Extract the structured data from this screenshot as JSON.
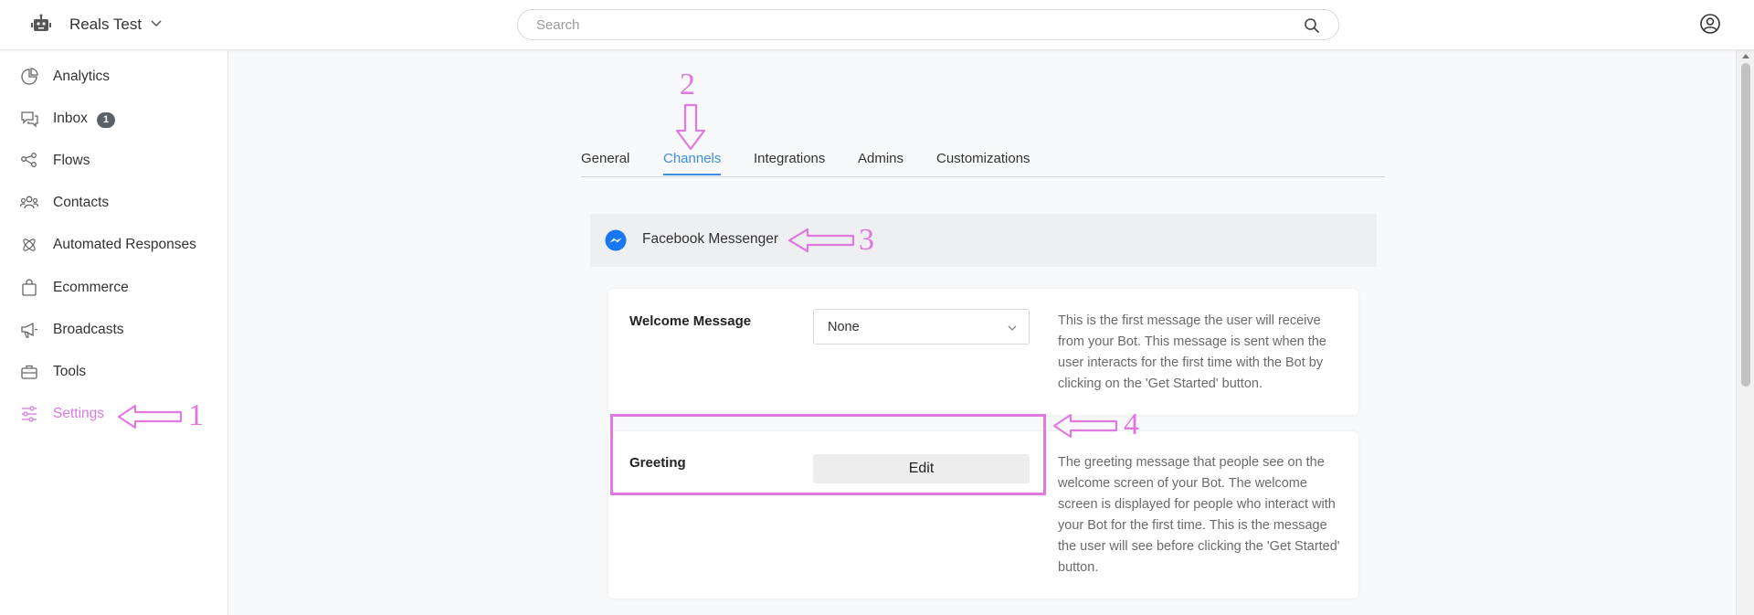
{
  "header": {
    "bot_name": "Reals Test",
    "search_placeholder": "Search"
  },
  "sidebar": {
    "items": [
      {
        "label": "Analytics",
        "icon": "analytics-icon"
      },
      {
        "label": "Inbox",
        "icon": "inbox-icon",
        "badge": "1"
      },
      {
        "label": "Flows",
        "icon": "flows-icon"
      },
      {
        "label": "Contacts",
        "icon": "contacts-icon"
      },
      {
        "label": "Automated Responses",
        "icon": "automated-responses-icon"
      },
      {
        "label": "Ecommerce",
        "icon": "ecommerce-icon"
      },
      {
        "label": "Broadcasts",
        "icon": "broadcasts-icon"
      },
      {
        "label": "Tools",
        "icon": "tools-icon"
      },
      {
        "label": "Settings",
        "icon": "settings-icon",
        "active": true
      }
    ]
  },
  "tabs": [
    {
      "label": "General"
    },
    {
      "label": "Channels",
      "active": true
    },
    {
      "label": "Integrations"
    },
    {
      "label": "Admins"
    },
    {
      "label": "Customizations"
    }
  ],
  "channel": {
    "title": "Facebook Messenger"
  },
  "welcome_message": {
    "label": "Welcome Message",
    "select_value": "None",
    "description": "This is the first message the user will receive from your Bot. This message is sent when the user interacts for the first time with the Bot by clicking on the 'Get Started' button."
  },
  "greeting": {
    "label": "Greeting",
    "button_label": "Edit",
    "description": "The greeting message that people see on the welcome screen of your Bot. The welcome screen is displayed for people who interact with your Bot for the first time. This is the message the user will see before clicking the 'Get Started' button."
  },
  "annotations": {
    "one": "1",
    "two": "2",
    "three": "3",
    "four": "4",
    "color": "#e07ae0"
  },
  "colors": {
    "accent": "#3b8de0",
    "active_nav": "#d67ce0",
    "messenger": "#1877f2"
  }
}
